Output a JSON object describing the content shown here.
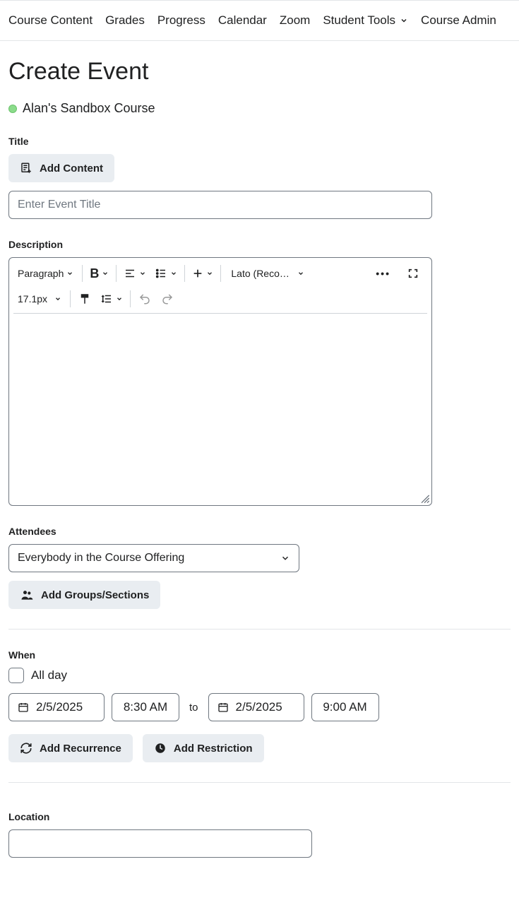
{
  "nav": {
    "items": [
      {
        "label": "Course Content"
      },
      {
        "label": "Grades"
      },
      {
        "label": "Progress"
      },
      {
        "label": "Calendar"
      },
      {
        "label": "Zoom"
      },
      {
        "label": "Student Tools",
        "dropdown": true
      },
      {
        "label": "Course Admin"
      }
    ]
  },
  "page_title": "Create Event",
  "course": {
    "name": "Alan's Sandbox Course",
    "status_color": "#8bdc8b"
  },
  "title_section": {
    "label": "Title",
    "add_content_label": "Add Content",
    "placeholder": "Enter Event Title",
    "value": ""
  },
  "description_section": {
    "label": "Description",
    "toolbar": {
      "block_format": "Paragraph",
      "font_family": "Lato (Recomme…",
      "font_size": "17.1px"
    }
  },
  "attendees_section": {
    "label": "Attendees",
    "selected": "Everybody in the Course Offering",
    "add_groups_label": "Add Groups/Sections"
  },
  "when_section": {
    "label": "When",
    "all_day_label": "All day",
    "all_day_checked": false,
    "start_date": "2/5/2025",
    "start_time": "8:30 AM",
    "to_label": "to",
    "end_date": "2/5/2025",
    "end_time": "9:00 AM",
    "add_recurrence_label": "Add Recurrence",
    "add_restriction_label": "Add Restriction"
  },
  "location_section": {
    "label": "Location",
    "value": ""
  }
}
